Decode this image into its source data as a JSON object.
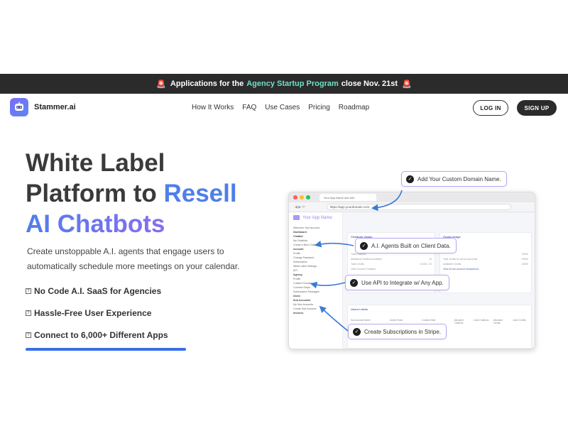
{
  "announcement": {
    "flag_left": "🚨",
    "prefix": "Applications for the",
    "highlight": "Agency Startup Program",
    "suffix": "close Nov. 21st",
    "flag_right": "🚨",
    "highlight_color": "#6fe0c8"
  },
  "brand": {
    "name": "Stammer.ai",
    "logo_icon": "robot-face-icon"
  },
  "nav": {
    "items": [
      "How It Works",
      "FAQ",
      "Use Cases",
      "Pricing",
      "Roadmap"
    ]
  },
  "auth": {
    "login": "LOG IN",
    "signup": "SIGN UP"
  },
  "hero": {
    "title_line1": "White Label",
    "title_line2_a": "Platform to ",
    "title_line2_b": "Resell",
    "title_line3": "AI Chatbots",
    "subtitle": "Create unstoppable A.I. agents that engage users to automatically schedule more meetings on your calendar.",
    "features": [
      "No Code A.I. SaaS for Agencies",
      "Hassle-Free User Experience",
      "Connect to 6,000+ Different Apps"
    ],
    "feature_bullet": "?",
    "accent_color": "#4f7fea"
  },
  "mock": {
    "tab_label": "Your App Name and Info",
    "url": "https://app.yourdomain.com",
    "app_name": "Your App Name",
    "sidebar": [
      "Welcome Your Account",
      "Dashboard",
      "Chatbot",
      "My Chatbots",
      "Create a New Chatbot",
      "Account",
      "Profile",
      "Change Password",
      "Subscription",
      "White Label Settings",
      "API",
      "Agency",
      "Profile",
      "Custom Domain",
      "Connect Stripe",
      "Subscription Packages",
      "Users",
      "Sub-Accounts",
      "My Sub-Accounts",
      "Create Sub-Account",
      "Invoices"
    ],
    "card_left_title": "Chatbots Usage",
    "card_right_title": "Quota Usage",
    "card_bottom_title": "Users Limits",
    "left_rows": [
      [
        "Total Chatbots",
        ""
      ],
      [
        "Additional Chatbots available",
        "10"
      ],
      [
        "Total Credits",
        "10,000 / 10"
      ],
      [
        "Used Custom Chatbots",
        ""
      ]
    ],
    "right_rows": [
      [
        "",
        "10000"
      ],
      [
        "Total credits for all sub accounts",
        "10000"
      ],
      [
        "Available Credits",
        "10000"
      ],
      [
        "View all sub-account transactions",
        ""
      ]
    ],
    "table_headers": [
      "Sub-Account Name",
      "Admin Email",
      "Created Date",
      "Allocated Chatbots",
      "Used Chatbots",
      "Allocated Credits",
      "Used Credits"
    ]
  },
  "callouts": {
    "domain": "Add Your Custom Domain Name.",
    "agents": "A.I. Agents Built on Client Data.",
    "api": "Use API to Integrate w/ Any App.",
    "stripe": "Create Subscriptions in Stripe."
  }
}
